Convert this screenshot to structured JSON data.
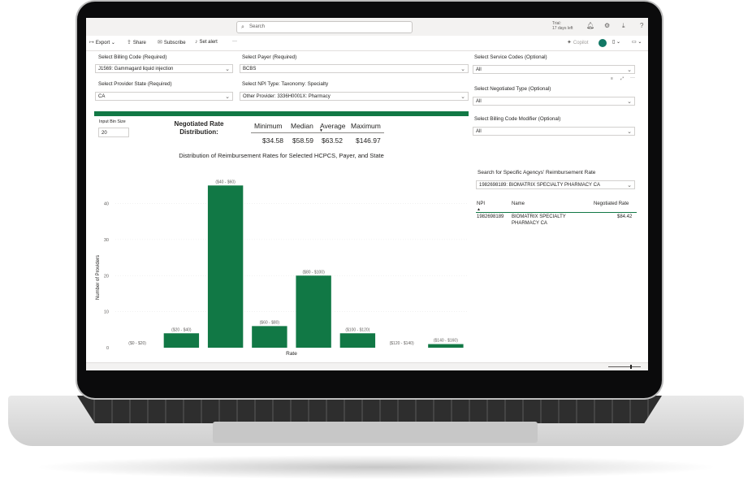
{
  "topbar": {
    "search_placeholder": "Search",
    "trial_line1": "Trial:",
    "trial_line2": "17 days left"
  },
  "toolbar": {
    "export": "Export",
    "share": "Share",
    "subscribe": "Subscribe",
    "set_alert": "Set alert",
    "more": "···",
    "copilot": "Copilot"
  },
  "filters": {
    "billing_code_label": "Select Billing Code (Required)",
    "billing_code_value": "J1569: Gammagard liquid injection",
    "payer_label": "Select Payer (Required)",
    "payer_value": "BCBS",
    "service_codes_label": "Select Service Codes (Optional)",
    "service_codes_value": "All",
    "provider_state_label": "Select Provider State (Required)",
    "provider_state_value": "CA",
    "npi_type_label": "Select NPI Type: Taxonomy: Specialty",
    "npi_type_value": "Other Provider: 3336H0001X: Pharmacy",
    "negotiated_type_label": "Select Negotiated Type (Optional)",
    "negotiated_type_value": "All",
    "billing_modifier_label": "Select Billing Code Modifier (Optional)",
    "billing_modifier_value": "All"
  },
  "bin": {
    "label": "Input Bin Size",
    "value": "20"
  },
  "distribution": {
    "title_line1": "Negotiated Rate",
    "title_line2": "Distribution:",
    "headers": [
      "Minimum",
      "Median",
      "Average",
      "Maximum"
    ],
    "values": [
      "$34.58",
      "$58.59",
      "$63.52",
      "$146.97"
    ]
  },
  "chart_data": {
    "type": "bar",
    "title": "Distribution of Reimbursement Rates for Selected HCPCS, Payer, and State",
    "xlabel": "Rate",
    "ylabel": "Number of Providers",
    "ylim": [
      0,
      48
    ],
    "yticks": [
      0,
      10,
      20,
      30,
      40
    ],
    "categories": [
      "($0 - $20)",
      "($20 - $40)",
      "($40 - $60)",
      "($60 - $80)",
      "($80 - $100)",
      "($100 - $120)",
      "($120 - $140)",
      "($140 - $160)"
    ],
    "values": [
      0,
      4,
      45,
      6,
      20,
      4,
      0,
      1
    ],
    "color": "#117845"
  },
  "agency": {
    "search_label": "Search for Specific Agencys' Reimbursement Rate",
    "search_value": "1982698189: BIOMATRIX SPECIALTY PHARMACY CA",
    "col_npi": "NPI",
    "col_name": "Name",
    "col_rate": "Negotiated Rate",
    "row_npi": "1982698189",
    "row_name_1": "BIOMATRIX SPECIALTY",
    "row_name_2": "PHARMACY CA",
    "row_rate": "$84.42"
  },
  "colors": {
    "accent": "#117845",
    "avatar": "#117865"
  }
}
